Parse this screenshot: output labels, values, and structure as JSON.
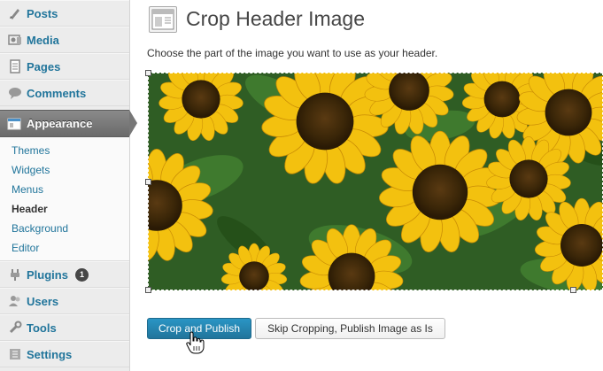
{
  "sidebar": {
    "items": [
      {
        "label": "Posts",
        "icon": "posts-icon"
      },
      {
        "label": "Media",
        "icon": "media-icon"
      },
      {
        "label": "Pages",
        "icon": "pages-icon"
      },
      {
        "label": "Comments",
        "icon": "comments-icon"
      },
      {
        "label": "Appearance",
        "icon": "appearance-icon"
      },
      {
        "label": "Plugins",
        "icon": "plugins-icon",
        "badge": "1"
      },
      {
        "label": "Users",
        "icon": "users-icon"
      },
      {
        "label": "Tools",
        "icon": "tools-icon"
      },
      {
        "label": "Settings",
        "icon": "settings-icon"
      }
    ],
    "submenu": [
      "Themes",
      "Widgets",
      "Menus",
      "Header",
      "Background",
      "Editor"
    ],
    "current_submenu": "Header"
  },
  "main": {
    "title": "Crop Header Image",
    "instruction": "Choose the part of the image you want to use as your header.",
    "buttons": {
      "crop_publish": "Crop and Publish",
      "skip_crop": "Skip Cropping, Publish Image as Is"
    }
  },
  "colors": {
    "link": "#21759b",
    "primary_button": "#21759b",
    "appearance_active": "#777777"
  }
}
